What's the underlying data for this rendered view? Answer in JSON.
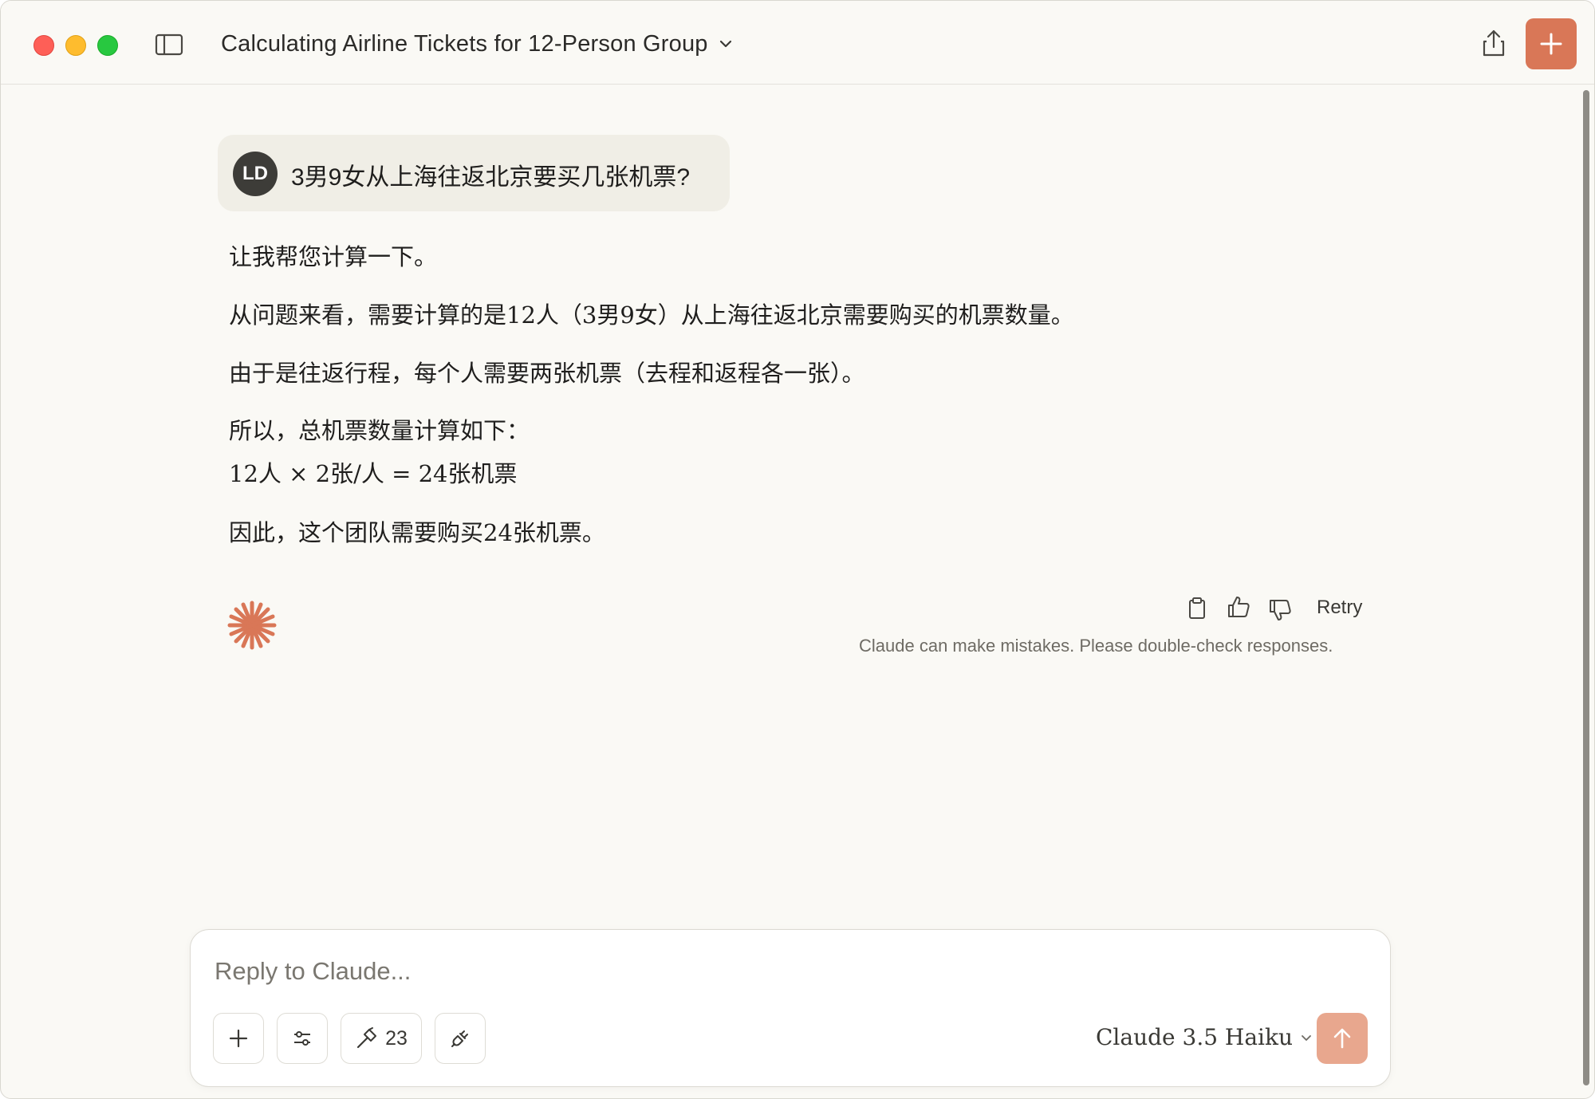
{
  "window": {
    "title": "Calculating Airline Tickets for 12-Person Group"
  },
  "conversation": {
    "user": {
      "avatar_initials": "LD",
      "message": "3男9女从上海往返北京要买几张机票?"
    },
    "assistant": {
      "paragraphs": [
        "让我帮您计算一下。",
        "从问题来看，需要计算的是12人（3男9女）从上海往返北京需要购买的机票数量。",
        "由于是往返行程，每个人需要两张机票（去程和返程各一张）。",
        "所以，总机票数量计算如下：",
        "12人 × 2张/人 = 24张机票",
        "因此，这个团队需要购买24张机票。"
      ],
      "actions": {
        "retry_label": "Retry"
      },
      "disclaimer": "Claude can make mistakes. Please double-check responses."
    }
  },
  "composer": {
    "placeholder": "Reply to Claude...",
    "tools_count": "23",
    "model_name": "Claude 3.5 Haiku"
  },
  "colors": {
    "accent": "#d97757",
    "send_disabled": "#e8a78e",
    "background": "#faf9f5",
    "user_bubble": "#f0eee6"
  },
  "icons": {
    "sidebar": "sidebar-icon",
    "share": "share-icon",
    "new_chat": "plus-icon",
    "copy": "clipboard-icon",
    "thumbs_up": "thumbs-up-icon",
    "thumbs_down": "thumbs-down-icon",
    "attach": "plus-icon",
    "settings": "sliders-icon",
    "tools": "hammer-icon",
    "integrations": "plug-icon",
    "send": "arrow-up-icon"
  }
}
